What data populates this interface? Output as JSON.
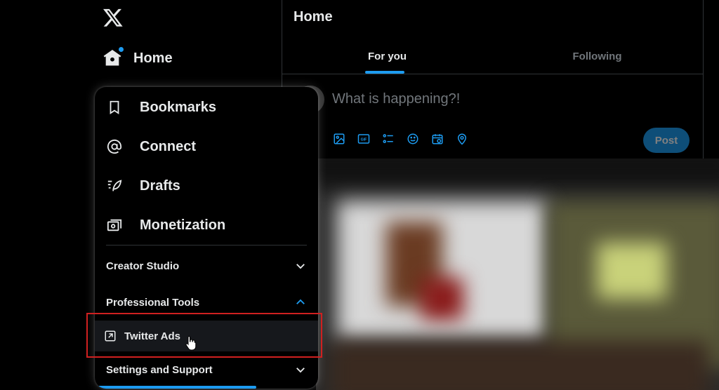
{
  "nav": {
    "home_label": "Home"
  },
  "main": {
    "title": "Home",
    "tabs": [
      {
        "label": "For you",
        "active": true
      },
      {
        "label": "Following",
        "active": false
      }
    ],
    "compose": {
      "placeholder": "What is happening?!",
      "post_label": "Post",
      "tools": [
        "image-icon",
        "gif-icon",
        "poll-icon",
        "emoji-icon",
        "schedule-icon",
        "location-icon"
      ]
    }
  },
  "menu": {
    "items": [
      {
        "label": "Bookmarks",
        "icon": "bookmark-icon"
      },
      {
        "label": "Connect",
        "icon": "at-icon"
      },
      {
        "label": "Drafts",
        "icon": "drafts-icon"
      },
      {
        "label": "Monetization",
        "icon": "money-icon"
      }
    ],
    "sections": {
      "creator_studio": "Creator Studio",
      "professional_tools": "Professional Tools",
      "settings_support": "Settings and Support"
    },
    "twitter_ads": "Twitter Ads"
  },
  "colors": {
    "accent": "#1d9bf0",
    "highlight_box": "#d02020"
  }
}
